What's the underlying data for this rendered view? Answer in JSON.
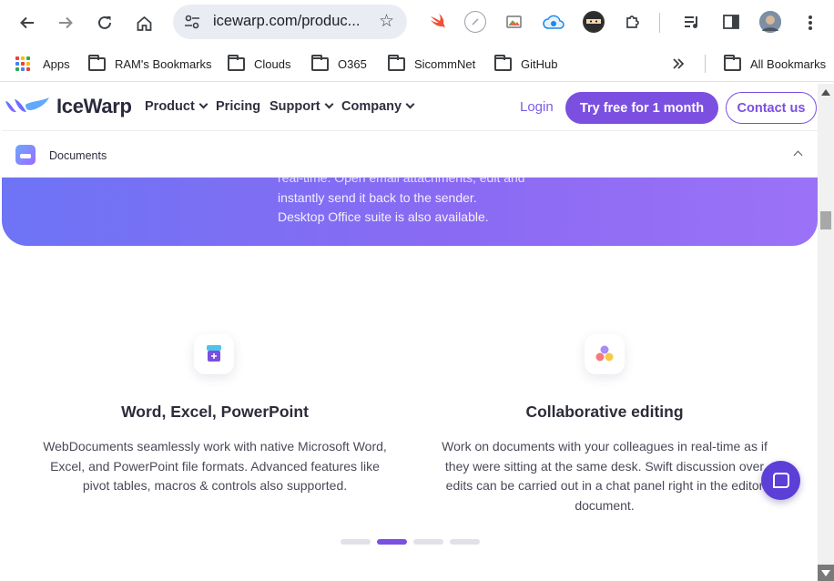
{
  "browser": {
    "url": "icewarp.com/produc...",
    "bookmarks": [
      {
        "label": "Apps",
        "type": "apps"
      },
      {
        "label": "RAM's Bookmarks",
        "type": "folder"
      },
      {
        "label": "Clouds",
        "type": "folder"
      },
      {
        "label": "O365",
        "type": "folder"
      },
      {
        "label": "SicommNet",
        "type": "folder"
      },
      {
        "label": "GitHub",
        "type": "folder"
      }
    ],
    "overflow_icon": "double-chevron-right-icon",
    "all_bookmarks": "All Bookmarks"
  },
  "site": {
    "brand": "IceWarp",
    "nav": {
      "product": "Product",
      "pricing": "Pricing",
      "support": "Support",
      "company": "Company",
      "login": "Login",
      "try_free": "Try free for 1 month",
      "contact": "Contact us"
    },
    "subnav": {
      "label": "Documents"
    },
    "banner": {
      "line1": "real-time. Open email attachments, edit and",
      "line2": "instantly send it back to the sender.",
      "line3": "Desktop Office suite is also available."
    },
    "features": [
      {
        "title": "Word, Excel, PowerPoint",
        "line1": "WebDocuments seamlessly work with native Microsoft Word,",
        "line2": "Excel, and PowerPoint file formats. Advanced features like",
        "line3": "pivot tables, macros & controls also supported."
      },
      {
        "title": "Collaborative editing",
        "line1": "Work on documents with your colleagues in real-time as if",
        "line2": "they were sitting at the same desk. Swift discussion over",
        "line3": "edits can be carried out in a chat panel right in the editor",
        "line4": "document."
      }
    ],
    "carousel": {
      "count": 4,
      "active_index": 1
    }
  },
  "colors": {
    "accent": "#7b4fe0",
    "banner_start": "#6d74f5",
    "banner_end": "#9b72f7"
  }
}
